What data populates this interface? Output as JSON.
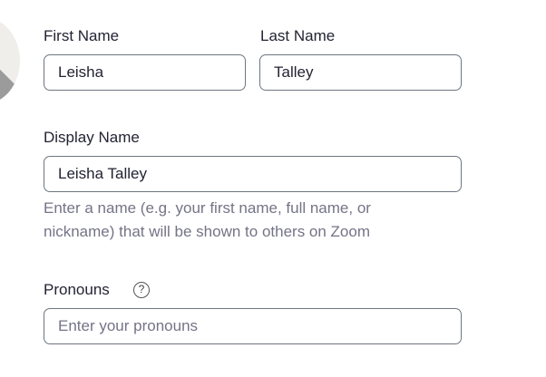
{
  "profile": {
    "first_name": {
      "label": "First Name",
      "value": "Leisha"
    },
    "last_name": {
      "label": "Last Name",
      "value": "Talley"
    },
    "display_name": {
      "label": "Display Name",
      "value": "Leisha Talley",
      "help_line_1": "Enter a name (e.g. your first name, full name, or",
      "help_line_2": "nickname) that will be shown to others on Zoom"
    },
    "pronouns": {
      "label": "Pronouns",
      "help_icon_glyph": "?",
      "placeholder": "Enter your pronouns",
      "value": ""
    }
  },
  "icons": {
    "avatar": "user-avatar",
    "help": "question-circle-icon"
  },
  "colors": {
    "text": "#232333",
    "muted_text": "#747487",
    "input_border": "#6e7680",
    "avatar_bg": "#efeeea"
  }
}
